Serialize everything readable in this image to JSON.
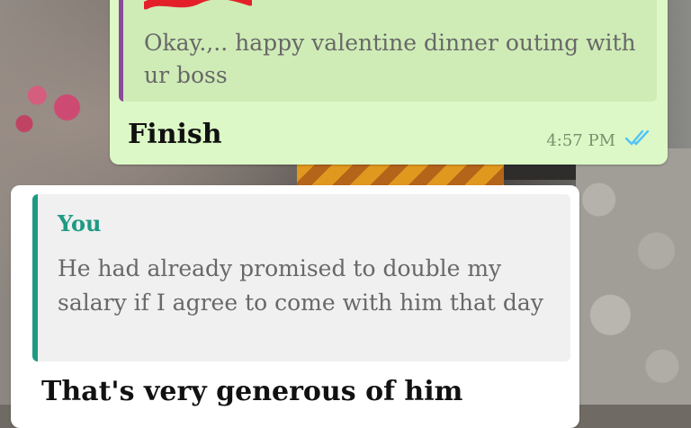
{
  "conversation": {
    "outgoing": {
      "quoted_text": "Okay.,.. happy valentine dinner outing with ur boss",
      "text": "Finish",
      "time": "4:57 PM",
      "status_icon": "double-check-icon"
    },
    "incoming": {
      "quoted_sender": "You",
      "quoted_text": "He had already promised to double my salary if I agree to come with him that day",
      "text": "That's very generous of him"
    }
  },
  "colors": {
    "outgoing_bubble": "#dcf8c6",
    "incoming_bubble": "#ffffff",
    "quote_bar_outgoing": "#8a4c9a",
    "quote_bar_incoming": "#1e9a84",
    "read_ticks": "#4fc3f7",
    "scribble": "#e3202a"
  }
}
